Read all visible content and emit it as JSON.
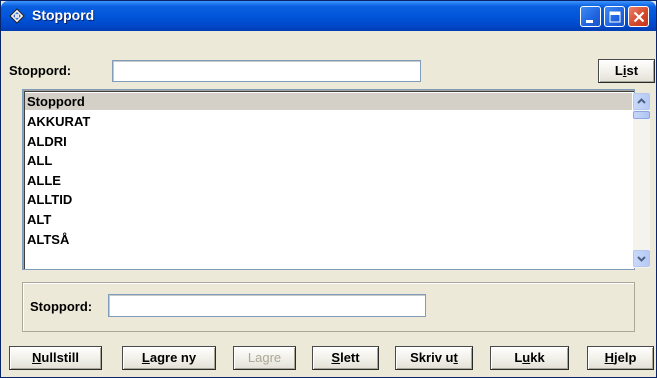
{
  "window": {
    "title": "Stoppord"
  },
  "filter": {
    "label": "Stoppord:",
    "value": "",
    "list_button": "List",
    "list_button_accel": "i"
  },
  "list": {
    "header": "Stoppord",
    "items": [
      "AKKURAT",
      "ALDRI",
      "ALL",
      "ALLE",
      "ALLTID",
      "ALT",
      "ALTSÅ"
    ]
  },
  "edit": {
    "label": "Stoppord:",
    "value": ""
  },
  "buttons": [
    {
      "label": "Nullstill",
      "accel_index": 0,
      "enabled": true
    },
    {
      "label": "Lagre ny",
      "accel_index": 0,
      "enabled": true
    },
    {
      "label": "Lagre",
      "accel_index": -1,
      "enabled": false
    },
    {
      "label": "Slett",
      "accel_index": 0,
      "enabled": true
    },
    {
      "label": "Skriv ut",
      "accel_index": 7,
      "enabled": true
    },
    {
      "label": "Lukk",
      "accel_index": 1,
      "enabled": true
    },
    {
      "label": "Hjelp",
      "accel_index": 0,
      "enabled": true
    }
  ]
}
